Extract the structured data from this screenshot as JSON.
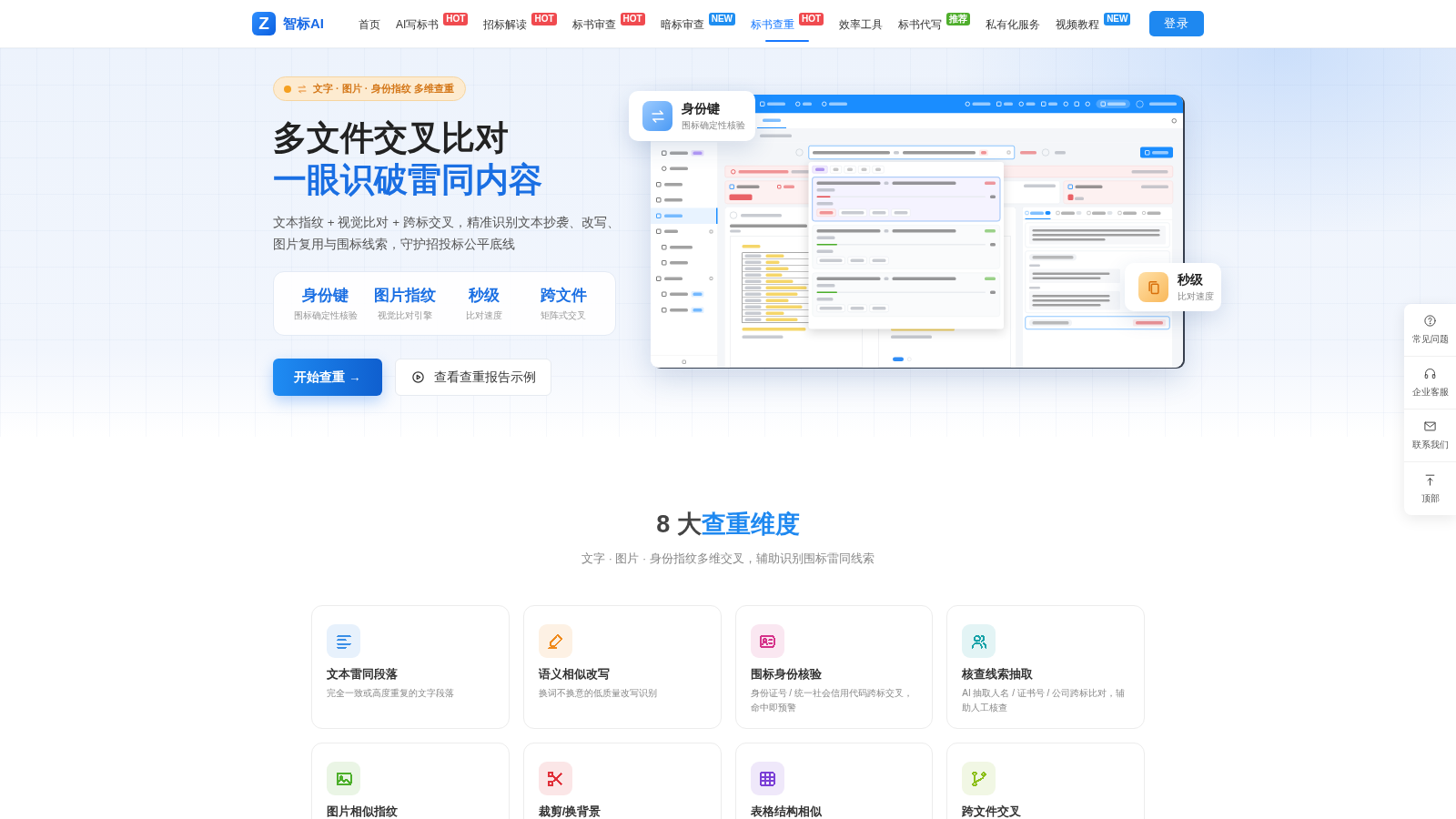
{
  "nav": {
    "logo_mark": "Z",
    "brand": "智标AI",
    "items": [
      {
        "label": "首页",
        "selected": false
      },
      {
        "label": "AI写标书",
        "selected": false,
        "badge": {
          "label": "HOT",
          "color": "#f04a4f"
        }
      },
      {
        "label": "招标解读",
        "selected": false,
        "badge": {
          "label": "HOT",
          "color": "#f04a4f"
        }
      },
      {
        "label": "标书审查",
        "selected": false,
        "badge": {
          "label": "HOT",
          "color": "#f04a4f"
        }
      },
      {
        "label": "暗标审查",
        "selected": false,
        "badge": {
          "label": "NEW",
          "color": "#1f8ef1"
        }
      },
      {
        "label": "标书查重",
        "selected": true,
        "badge": {
          "label": "HOT",
          "color": "#f04a4f"
        }
      },
      {
        "label": "效率工具",
        "selected": false
      },
      {
        "label": "标书代写",
        "selected": false,
        "badge": {
          "label": "推荐",
          "color": "#4fae2c"
        }
      },
      {
        "label": "私有化服务",
        "selected": false
      },
      {
        "label": "视频教程",
        "selected": false,
        "badge": {
          "label": "NEW",
          "color": "#1f8ef1"
        }
      }
    ],
    "login_button": "登录"
  },
  "hero": {
    "tag": "文字 · 图片 · 身份指纹 多维查重",
    "title": "多文件交叉比对",
    "highlight_title": "一眼识破雷同内容",
    "description": "文本指纹 + 视觉比对 + 跨标交叉，精准识别文本抄袭、改写、图片复用与围标线索，守护招投标公平底线",
    "stats": [
      {
        "value": "身份键",
        "label": "围标确定性核验"
      },
      {
        "value": "图片指纹",
        "label": "视觉比对引擎"
      },
      {
        "value": "秒级",
        "label": "比对速度"
      },
      {
        "value": "跨文件",
        "label": "矩阵式交叉"
      }
    ],
    "primary_button": "开始查重 →",
    "secondary_button": "查看查重报告示例"
  },
  "floating_cards": [
    {
      "title": "身份键",
      "subtitle": "围标确定性核验"
    },
    {
      "title": "秒级",
      "subtitle": "比对速度"
    }
  ],
  "side_tools": [
    {
      "label": "常见问题"
    },
    {
      "label": "企业客服"
    },
    {
      "label": "联系我们"
    },
    {
      "label": "顶部"
    }
  ],
  "dimensions": {
    "title_lead": "8 大",
    "title_highlight": "查重维度",
    "subtitle": "文字 · 图片 · 身份指纹多维交叉，辅助识别围标雷同线索",
    "cards": [
      {
        "title": "文本雷同段落",
        "description": "完全一致或高度重复的文字段落",
        "color": "#3a8ee6"
      },
      {
        "title": "语义相似改写",
        "description": "换词不换意的低质量改写识别",
        "color": "#ef8a1c"
      },
      {
        "title": "围标身份核验",
        "description": "身份证号 / 统一社会信用代码跨标交叉，命中即预警",
        "color": "#d6338a"
      },
      {
        "title": "核查线索抽取",
        "description": "AI 抽取人名 / 证书号 / 公司跨标比对，辅助人工核查",
        "color": "#17a2a8"
      },
      {
        "title": "图片相似指纹",
        "color": "#4caf2a"
      },
      {
        "title": "裁剪/换背景",
        "color": "#e0303a"
      },
      {
        "title": "表格结构相似",
        "color": "#7b3fd6"
      },
      {
        "title": "跨文件交叉",
        "color": "#8cbf1a"
      }
    ]
  }
}
